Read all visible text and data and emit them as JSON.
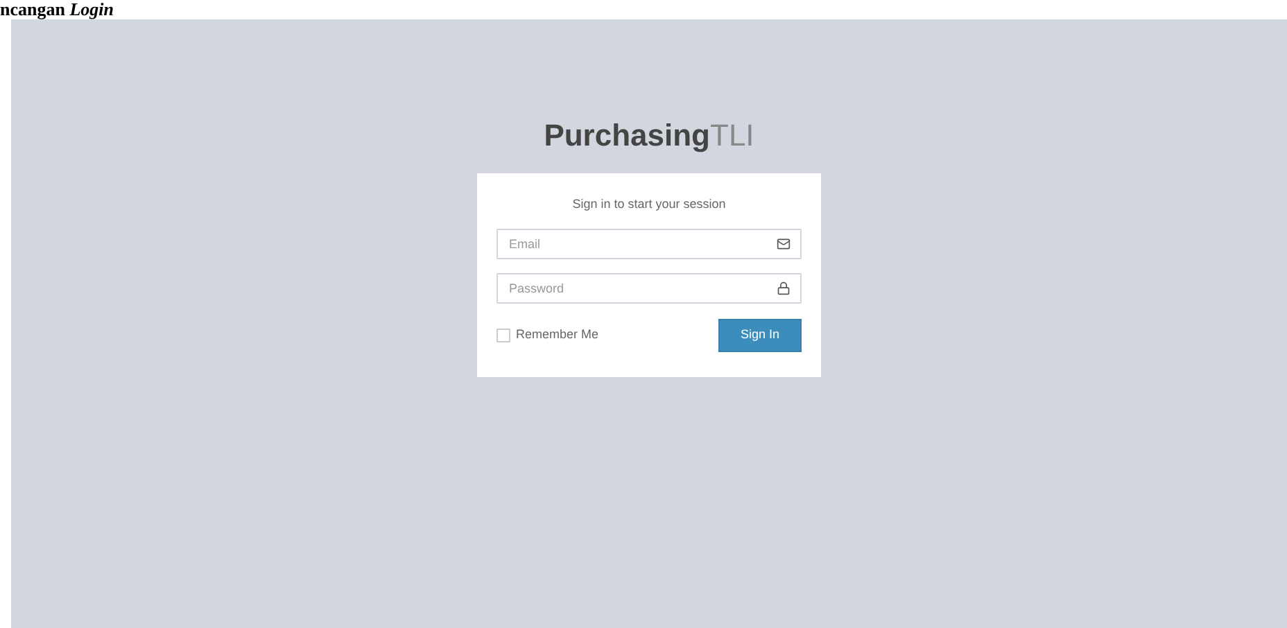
{
  "caption": "ncangan *Login*",
  "logo": {
    "bold": "Purchasing",
    "light": "TLI"
  },
  "card": {
    "message": "Sign in to start your session",
    "fields": [
      {
        "kind": "email",
        "placeholder": "Email"
      },
      {
        "kind": "password",
        "placeholder": "Password"
      }
    ],
    "remember": {
      "label": "Remember Me",
      "checked": false
    },
    "submit": "Sign In"
  }
}
